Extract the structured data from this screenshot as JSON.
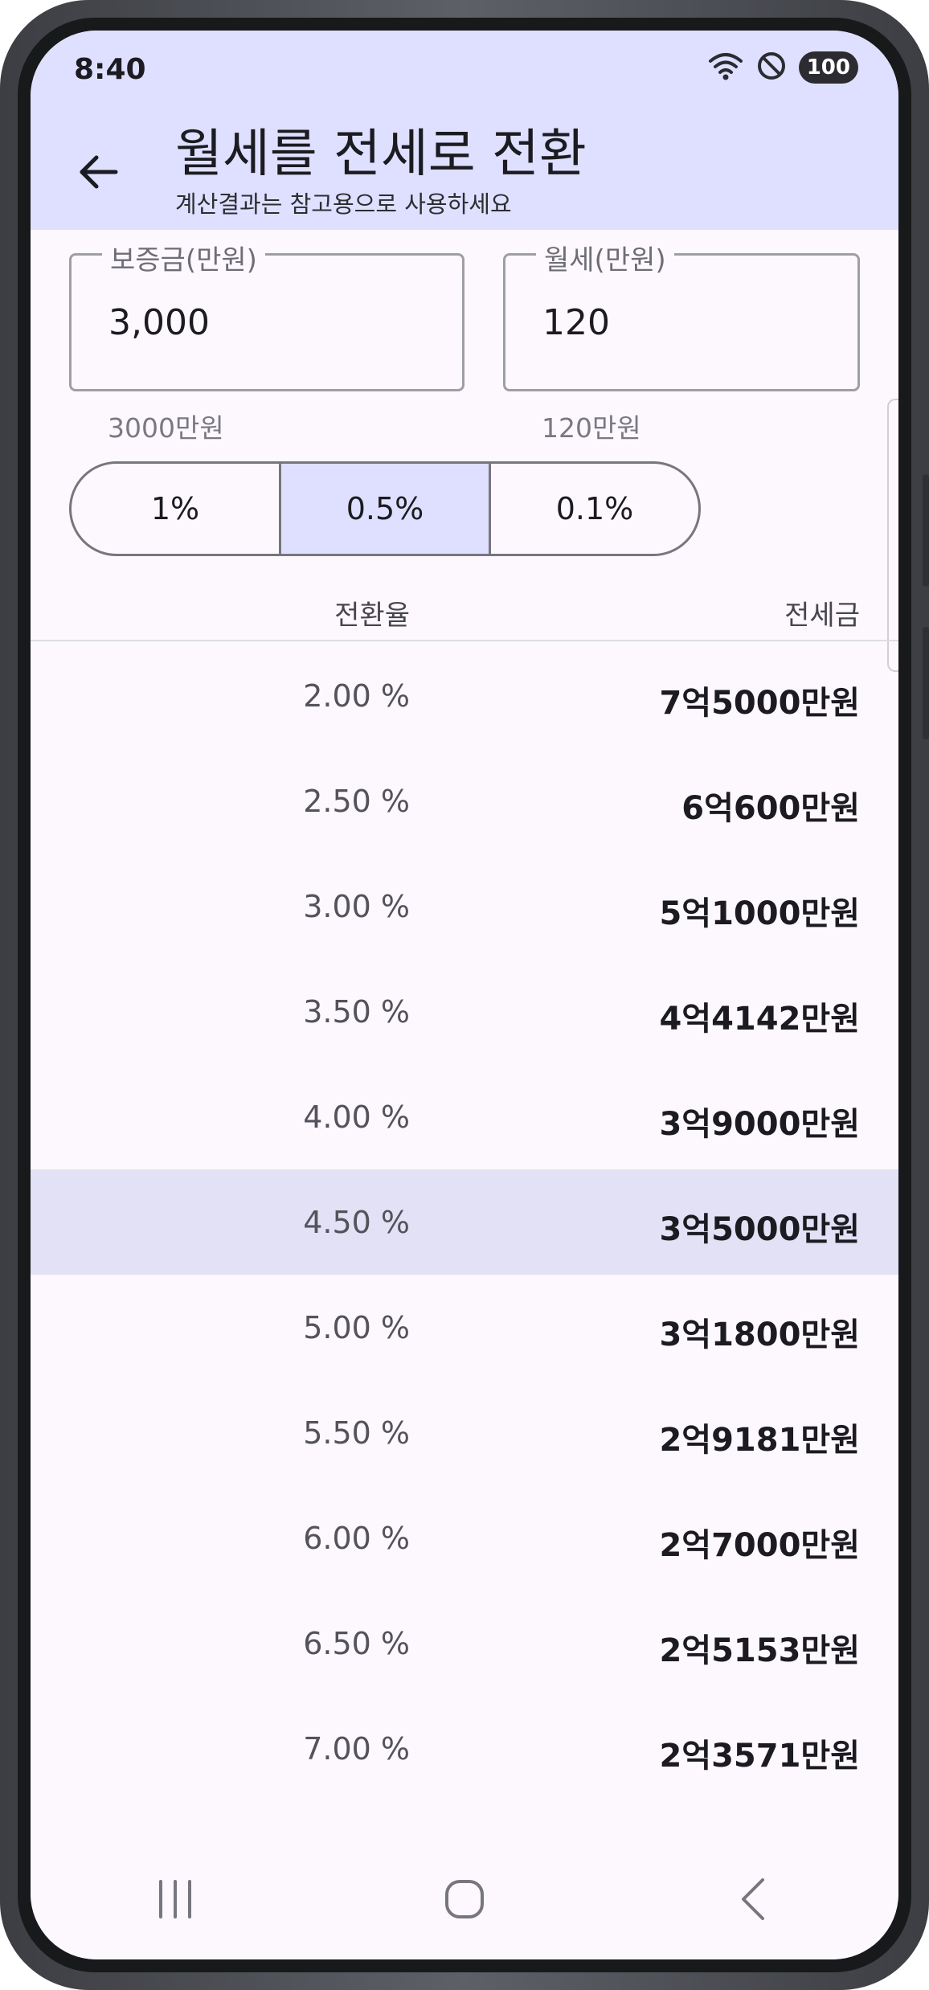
{
  "status_bar": {
    "time": "8:40",
    "battery": "100",
    "icons": [
      "wifi-icon",
      "do-not-disturb-icon",
      "battery-icon"
    ]
  },
  "header": {
    "title": "월세를 전세로 전환",
    "subtitle": "계산결과는 참고용으로 사용하세요",
    "back_icon": "arrow-left-icon"
  },
  "inputs": {
    "deposit": {
      "label": "보증금(만원)",
      "value": "3,000",
      "helper": "3000만원"
    },
    "monthly_rent": {
      "label": "월세(만원)",
      "value": "120",
      "helper": "120만원"
    }
  },
  "step_options": [
    {
      "label": "1%",
      "selected": false
    },
    {
      "label": "0.5%",
      "selected": true
    },
    {
      "label": "0.1%",
      "selected": false
    }
  ],
  "table": {
    "headers": {
      "rate": "전환율",
      "amount": "전세금"
    },
    "rows": [
      {
        "rate": "2.00 %",
        "amount": "7억5000만원",
        "highlight": false
      },
      {
        "rate": "2.50 %",
        "amount": "6억600만원",
        "highlight": false
      },
      {
        "rate": "3.00 %",
        "amount": "5억1000만원",
        "highlight": false
      },
      {
        "rate": "3.50 %",
        "amount": "4억4142만원",
        "highlight": false
      },
      {
        "rate": "4.00 %",
        "amount": "3억9000만원",
        "highlight": false
      },
      {
        "rate": "4.50 %",
        "amount": "3억5000만원",
        "highlight": true
      },
      {
        "rate": "5.00 %",
        "amount": "3억1800만원",
        "highlight": false
      },
      {
        "rate": "5.50 %",
        "amount": "2억9181만원",
        "highlight": false
      },
      {
        "rate": "6.00 %",
        "amount": "2억7000만원",
        "highlight": false
      },
      {
        "rate": "6.50 %",
        "amount": "2억5153만원",
        "highlight": false
      },
      {
        "rate": "7.00 %",
        "amount": "2억3571만원",
        "highlight": false
      }
    ]
  },
  "navigation": {
    "icons": [
      "recent-apps-icon",
      "home-icon",
      "back-icon"
    ]
  },
  "colors": {
    "header_bg": "#dfe0ff",
    "highlight_row": "#e2e1f5",
    "screen_bg": "#fdf8fd"
  }
}
